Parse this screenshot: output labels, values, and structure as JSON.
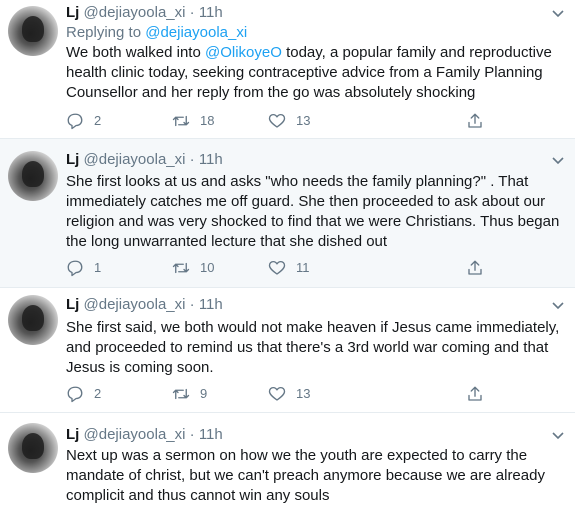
{
  "tweets": [
    {
      "name": "Lj",
      "handle": "@dejiayoola_xi",
      "sep": "·",
      "time": "11h",
      "replying_prefix": "Replying to ",
      "replying_to": "@dejiayoola_xi",
      "text_before": "We both walked into ",
      "mention": "@OlikoyeO",
      "text_after": " today, a popular family and reproductive health clinic today, seeking contraceptive advice from a Family Planning Counsellor and her reply from the go was absolutely shocking",
      "replies": "2",
      "retweets": "18",
      "likes": "13"
    },
    {
      "name": "Lj",
      "handle": "@dejiayoola_xi",
      "sep": "·",
      "time": "11h",
      "text": "She first looks at us and asks \"who needs the family planning?\" . That immediately catches me off guard. She then proceeded to ask about our religion and was very shocked to find that we were Christians. Thus began the long unwarranted lecture that she dished out",
      "replies": "1",
      "retweets": "10",
      "likes": "11"
    },
    {
      "name": "Lj",
      "handle": "@dejiayoola_xi",
      "sep": "·",
      "time": "11h",
      "text": "She first said, we both would not make heaven if Jesus came immediately, and proceeded to remind us that there's a 3rd world war coming and that Jesus is coming soon.",
      "replies": "2",
      "retweets": "9",
      "likes": "13"
    },
    {
      "name": "Lj",
      "handle": "@dejiayoola_xi",
      "sep": "·",
      "time": "11h",
      "text": "Next up was a sermon on how we the youth are expected to carry the mandate of christ, but we can't preach anymore because we are already complicit and thus cannot win any souls"
    }
  ],
  "colors": {
    "accent": "#1da1f2",
    "muted": "#657786",
    "text": "#14171a",
    "highlight_bg": "#f5f8fa"
  },
  "icons": {
    "reply": "reply-icon",
    "retweet": "retweet-icon",
    "like": "heart-icon",
    "share": "share-icon",
    "more": "chevron-down-icon"
  }
}
